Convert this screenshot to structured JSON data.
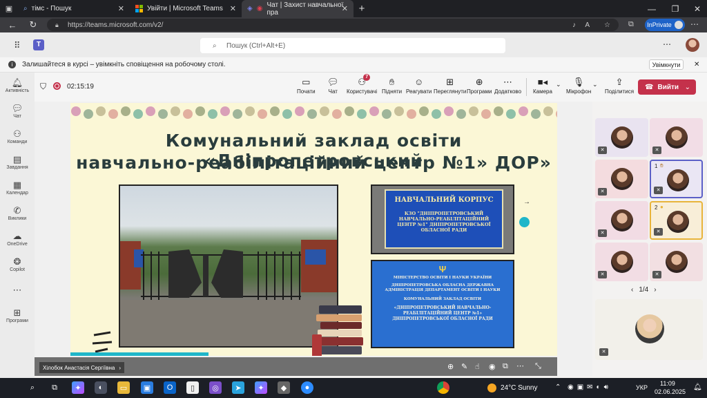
{
  "browser": {
    "tabs": [
      {
        "icon": "search-icon",
        "title": "тімс - Пошук"
      },
      {
        "icon": "microsoft-logo-icon",
        "title": "Увійти | Microsoft Teams"
      },
      {
        "icon": "teams-icon",
        "title": "Чат | Захист навчальної пра"
      }
    ],
    "url": "https://teams.microsoft.com/v2/",
    "inprivate_label": "InPrivate"
  },
  "teams": {
    "search_placeholder": "Пошук (Ctrl+Alt+E)",
    "banner_text": "Залишайтеся в курсі – увімкніть сповіщення на робочому столі.",
    "banner_button": "Увімкнути",
    "rail": [
      {
        "icon": "bell-icon",
        "label": "Активність"
      },
      {
        "icon": "chat-icon",
        "label": "Чат"
      },
      {
        "icon": "teams-people-icon",
        "label": "Команди"
      },
      {
        "icon": "clipboard-icon",
        "label": "Завдання"
      },
      {
        "icon": "calendar-icon",
        "label": "Календар"
      },
      {
        "icon": "phone-icon",
        "label": "Виклики"
      },
      {
        "icon": "cloud-icon",
        "label": "OneDrive"
      },
      {
        "icon": "copilot-icon",
        "label": "Copilot"
      },
      {
        "icon": "more-icon",
        "label": ""
      },
      {
        "icon": "plus-icon",
        "label": "Програми"
      }
    ]
  },
  "meeting": {
    "timer": "02:15:19",
    "toolbar": [
      {
        "icon": "whiteboard-icon",
        "label": "Почати"
      },
      {
        "icon": "chat-icon",
        "label": "Чат"
      },
      {
        "icon": "people-icon",
        "label": "Користувачі",
        "badge": "7"
      },
      {
        "icon": "hand-icon",
        "label": "Підняти"
      },
      {
        "icon": "smile-icon",
        "label": "Реагувати"
      },
      {
        "icon": "grid-icon",
        "label": "Переглянути"
      },
      {
        "icon": "apps-icon",
        "label": "Програми"
      },
      {
        "icon": "more-icon",
        "label": "Додатково"
      },
      {
        "icon": "camera-icon",
        "label": "Камера"
      },
      {
        "icon": "mic-off-icon",
        "label": "Мікрофон"
      },
      {
        "icon": "share-icon",
        "label": "Поділитися"
      }
    ],
    "leave_label": "Вийти",
    "presenter_name": "Хілобок Анастасія Сергіївна",
    "gallery_page": "1/4",
    "raised_hands": [
      "1",
      "2"
    ]
  },
  "slide": {
    "title_line1": "Комунальний заклад освіти «Дніпропетровський",
    "title_line2": "навчально-реабілітаційний центр №1» ДОР»",
    "sign1_title": "НАВЧАЛЬНИЙ КОРПУС",
    "sign1_body": "КЗО \"ДНІПРОПЕТРОВСЬКИЙ НАВЧАЛЬНО-РЕАБІЛІТАЦІЙНИЙ ЦЕНТР №1\" ДНІПРОПЕТРОВСЬКОЇ ОБЛАСНОЇ РАДИ",
    "sign2_line1": "МІНІСТЕРСТВО ОСВІТИ І НАУКИ УКРАЇНИ",
    "sign2_line2": "ДНІПРОПЕТРОВСЬКА ОБЛАСНА ДЕРЖАВНА АДМІНІСТРАЦІЯ ДЕПАРТАМЕНТ ОСВІТИ І НАУКИ",
    "sign2_line3": "КОМУНАЛЬНИЙ ЗАКЛАД ОСВІТИ",
    "sign2_line4": "«ДНІПРОПЕТРОВСЬКИЙ НАВЧАЛЬНО-РЕАБІЛІТАЦІЙНИЙ ЦЕНТР №1» ДНІПРОПЕТРОВСЬКОЇ ОБЛАСНОЇ РАДИ"
  },
  "taskbar": {
    "weather": "24°C  Sunny",
    "lang": "УКР",
    "time": "11:09",
    "date": "02.06.2025"
  }
}
